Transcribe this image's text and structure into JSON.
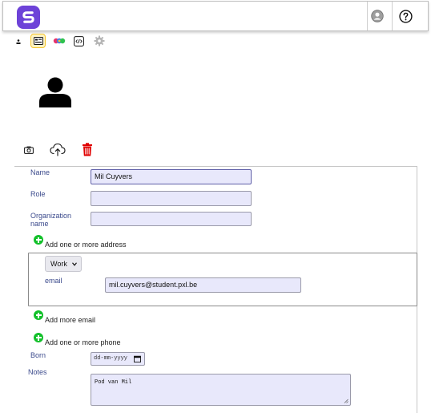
{
  "header": {
    "logo_icon": "brand-logo-icon",
    "account_icon": "account-circle-icon",
    "help_icon": "help-circle-icon",
    "brand_color": "#6d42d8"
  },
  "toolbar": {
    "icons": [
      "person-small-icon",
      "contact-card-icon",
      "tags-icon",
      "code-icon",
      "settings-gear-icon"
    ],
    "active_highlight": "#f5c52a"
  },
  "avatar": {
    "icon": "person-silhouette-icon"
  },
  "photo_actions": {
    "icons": [
      "camera-icon",
      "cloud-upload-icon",
      "trash-icon"
    ],
    "delete_color": "#e00000"
  },
  "form": {
    "name_label": "Name",
    "name_value": "Mil Cuyvers",
    "role_label": "Role",
    "role_value": "",
    "org_label_line1": "Organization",
    "org_label_line2": "name",
    "org_value": "",
    "add_address": "Add one or more address",
    "email_type": "Work",
    "email_label": "email",
    "email_value": "mil.cuyvers@student.pxl.be",
    "add_email": "Add more email",
    "add_phone": "Add one or more phone",
    "born_label": "Born",
    "born_placeholder": "dd-mm-yyyy",
    "notes_label": "Notes",
    "notes_value": "Pod van Mil",
    "add_color": "#12c02a",
    "input_bg": "#e8e8fb"
  }
}
